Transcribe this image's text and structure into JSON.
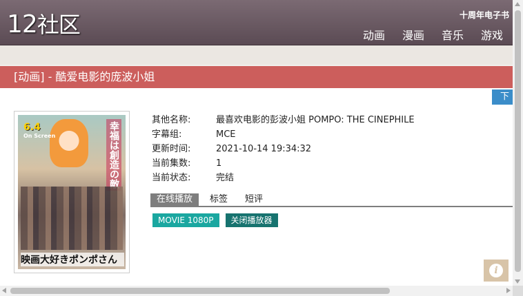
{
  "header": {
    "logo_num": "12",
    "logo_text": "社区",
    "tagline": "十周年电子书",
    "nav": [
      {
        "label": "动画"
      },
      {
        "label": "漫画"
      },
      {
        "label": "音乐"
      },
      {
        "label": "游戏"
      }
    ]
  },
  "banner": {
    "title": "[动画] - 酷爱电影的庞波小姐"
  },
  "download_tab": {
    "label": "下"
  },
  "poster": {
    "date": "6.4",
    "subtitle": "On Screen",
    "vertical_text": "幸福は創造の敵",
    "title": "映画大好きポンポさん"
  },
  "info": {
    "rows": [
      {
        "label": "其他名称:",
        "value": "最喜欢电影的彭波小姐 POMPO: THE CINEPHILE"
      },
      {
        "label": "字幕组:",
        "value": "MCE"
      },
      {
        "label": "更新时间:",
        "value": "2021-10-14 19:34:32"
      },
      {
        "label": "当前集数:",
        "value": "1"
      },
      {
        "label": "当前状态:",
        "value": "完结"
      }
    ]
  },
  "tabs": [
    {
      "label": "在线播放"
    },
    {
      "label": "标签"
    },
    {
      "label": "短评"
    }
  ],
  "buttons": {
    "movie": "MOVIE 1080P",
    "close": "关闭播放器"
  },
  "colors": {
    "header": "#6b5a63",
    "banner": "#cc5e5c",
    "teal": "#1aa7a0",
    "dark_teal": "#17736f",
    "blue": "#3b8dc9"
  },
  "icons": {
    "info": "info-icon"
  }
}
